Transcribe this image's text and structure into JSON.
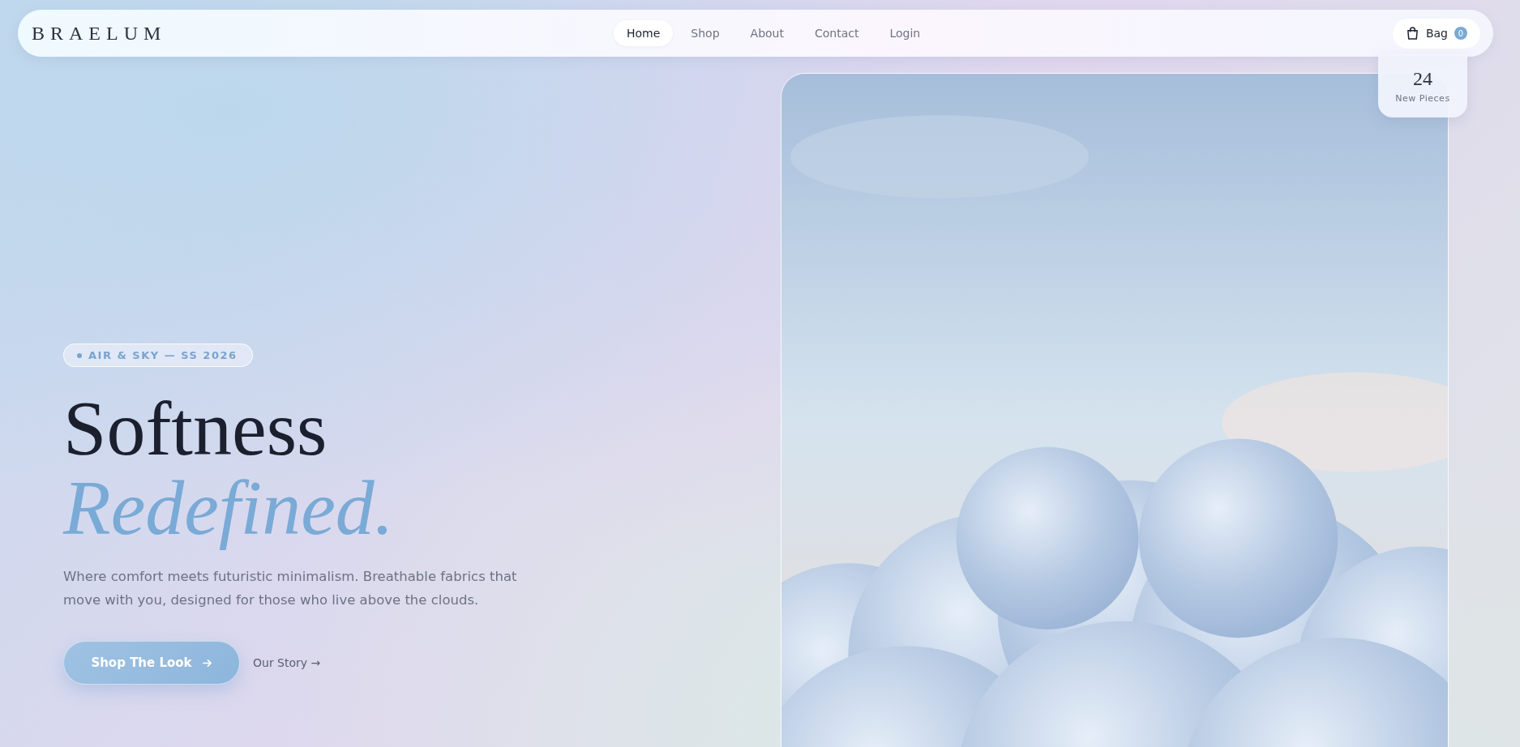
{
  "brand": "BRAELUM",
  "nav": [
    {
      "label": "Home",
      "selected": true
    },
    {
      "label": "Shop",
      "selected": false
    },
    {
      "label": "About",
      "selected": false
    },
    {
      "label": "Contact",
      "selected": false
    },
    {
      "label": "Login",
      "selected": false
    }
  ],
  "bag": {
    "label": "Bag",
    "count": "0"
  },
  "hero": {
    "tag": "AIR & SKY — SS 2026",
    "title_line_1": "Softness",
    "title_line_2": "Redefined.",
    "description": "Where comfort meets futuristic minimalism. Breathable fabrics that move with you, designed for those who live above the clouds.",
    "primary_button": "Shop The Look",
    "secondary_link": "Our Story →"
  },
  "stat": {
    "value": "24",
    "label": "New Pieces"
  }
}
